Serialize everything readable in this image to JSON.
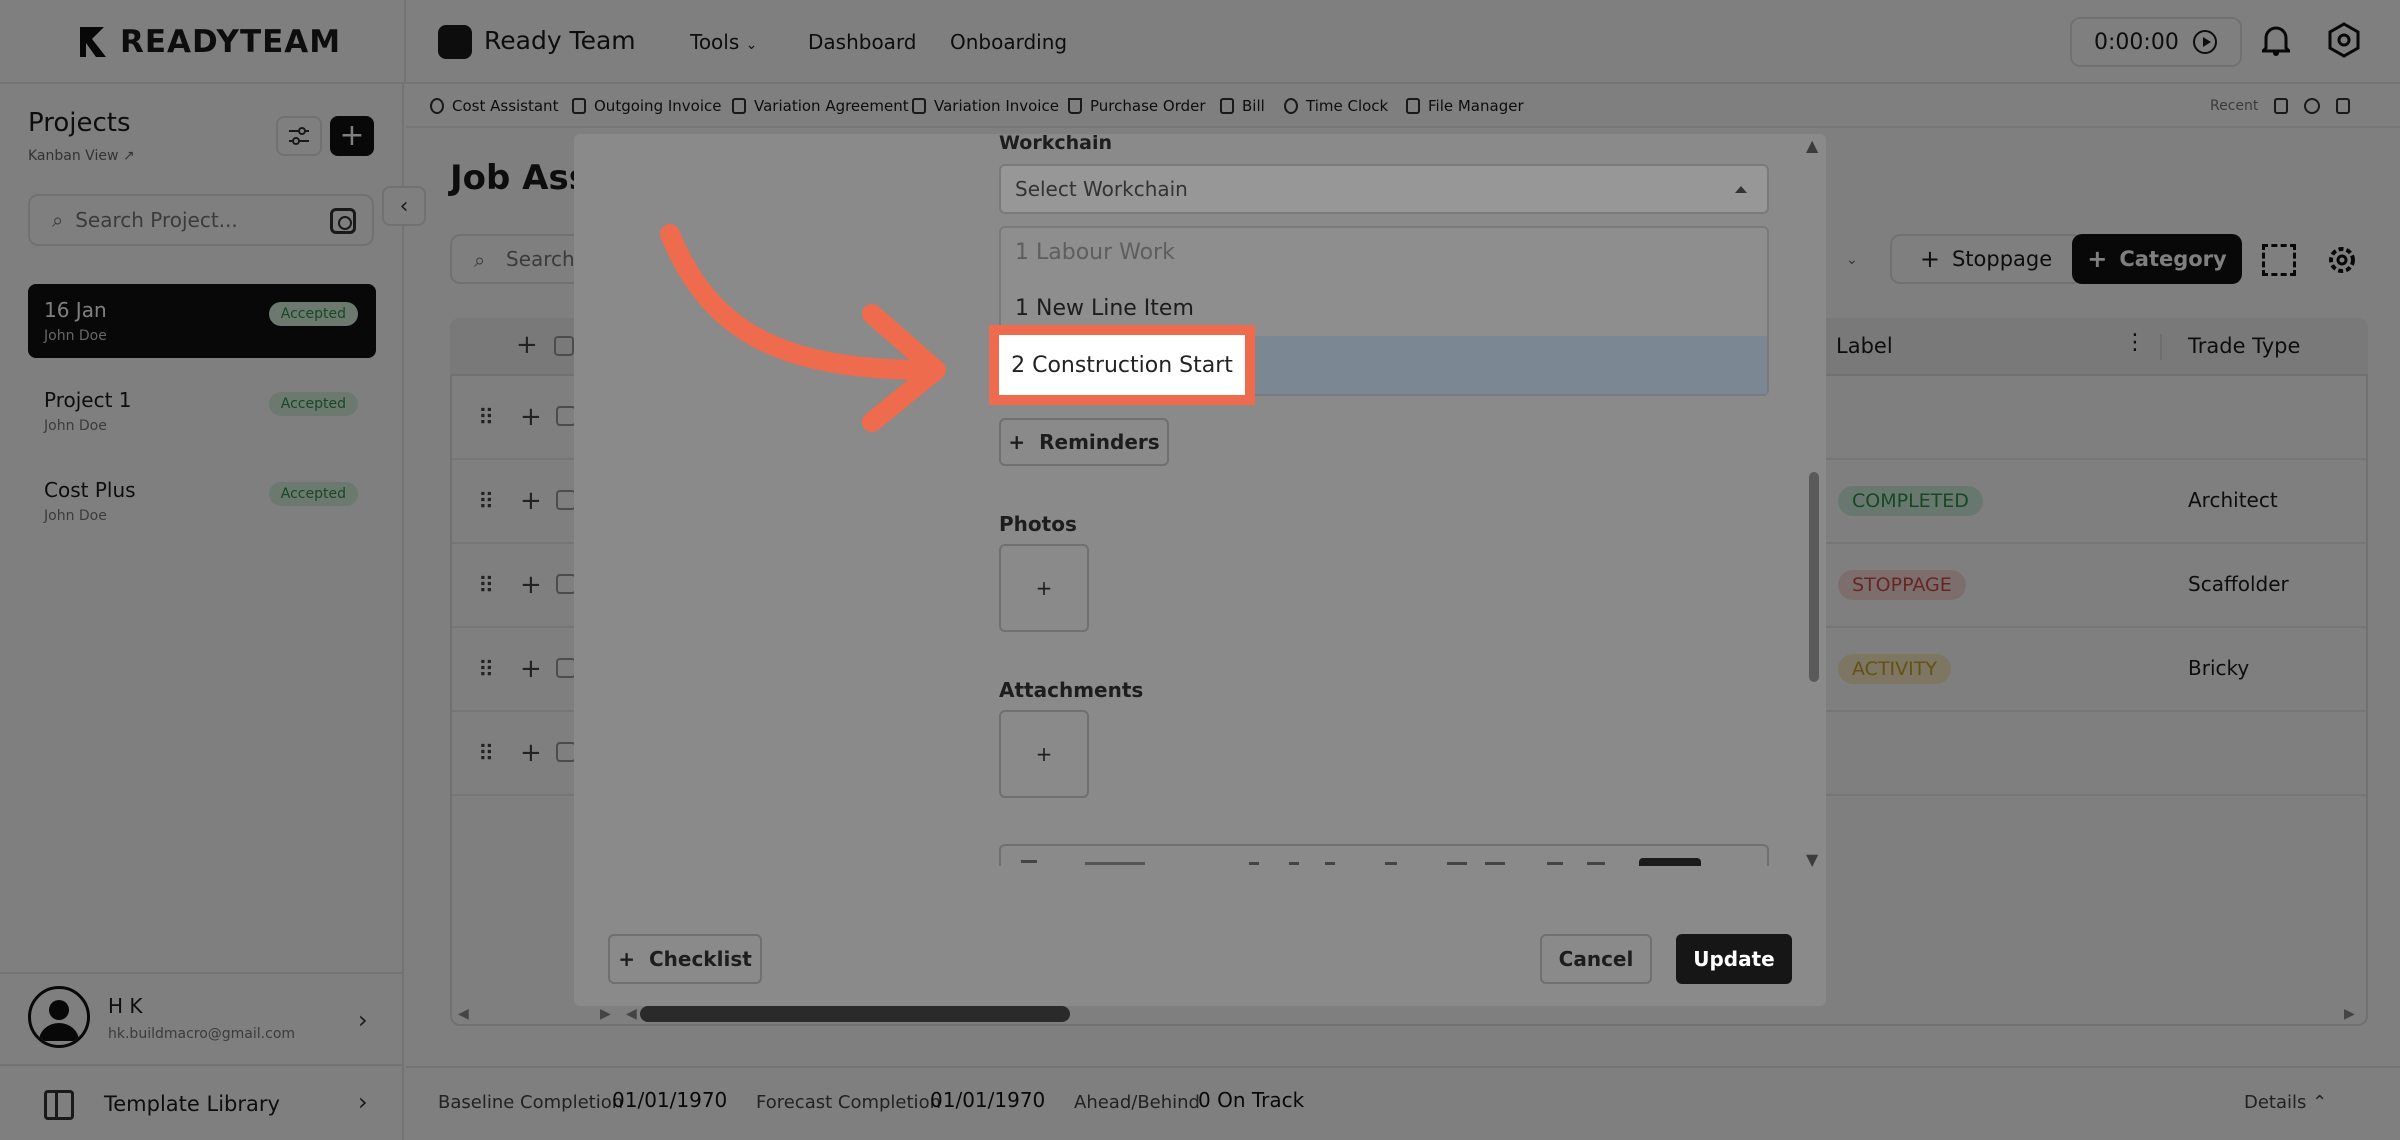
{
  "brand": {
    "name": "READYTEAM"
  },
  "header": {
    "app_title": "Ready Team",
    "nav": [
      "Tools",
      "Dashboard",
      "Onboarding"
    ],
    "timer": "0:00:00"
  },
  "sidebar": {
    "title": "Projects",
    "view_link": "Kanban View",
    "search_placeholder": "Search Project...",
    "projects": [
      {
        "name": "16 Jan",
        "owner": "John Doe",
        "status": "Accepted"
      },
      {
        "name": "Project 1",
        "owner": "John Doe",
        "status": "Accepted"
      },
      {
        "name": "Cost Plus",
        "owner": "John Doe",
        "status": "Accepted"
      }
    ],
    "user": {
      "name": "H K",
      "email": "hk.buildmacro@gmail.com"
    },
    "template_library": "Template Library"
  },
  "toolbar": {
    "items": [
      "Cost Assistant",
      "Outgoing Invoice",
      "Variation Agreement",
      "Variation Invoice",
      "Purchase Order",
      "Bill",
      "Time Clock",
      "File Manager"
    ],
    "recent": "Recent"
  },
  "main": {
    "title_partial": "Job Ass",
    "search_placeholder": "Search",
    "stoppage_button": "Stoppage",
    "category_button": "Category",
    "columns": {
      "label": "Label",
      "trade_type": "Trade Type"
    },
    "rows": [
      {
        "label": "",
        "trade": ""
      },
      {
        "label": "COMPLETED",
        "trade": "Architect"
      },
      {
        "label": "STOPPAGE",
        "trade": "Scaffolder"
      },
      {
        "label": "ACTIVITY",
        "trade": "Bricky"
      },
      {
        "label": "",
        "trade": ""
      }
    ]
  },
  "footer": {
    "baseline_label": "Baseline Completion",
    "baseline_value": "01/01/1970",
    "forecast_label": "Forecast Completion",
    "forecast_value": "01/01/1970",
    "ahead_label": "Ahead/Behind",
    "ahead_value": "0 On Track",
    "details": "Details"
  },
  "modal": {
    "workchain_label": "Workchain",
    "workchain_placeholder": "Select Workchain",
    "options": [
      "1 Labour Work",
      "1 New Line Item",
      "2 Construction Start"
    ],
    "highlighted_option": "2 Construction Start",
    "reminders_button": "Reminders",
    "photos_label": "Photos",
    "attachments_label": "Attachments",
    "add_symbol": "+",
    "checklist_button": "Checklist",
    "cancel_button": "Cancel",
    "update_button": "Update"
  },
  "colors": {
    "accent": "#ee6b4d",
    "completed": "#2f8f4a",
    "stoppage": "#d24a4a",
    "activity": "#c9a227"
  }
}
